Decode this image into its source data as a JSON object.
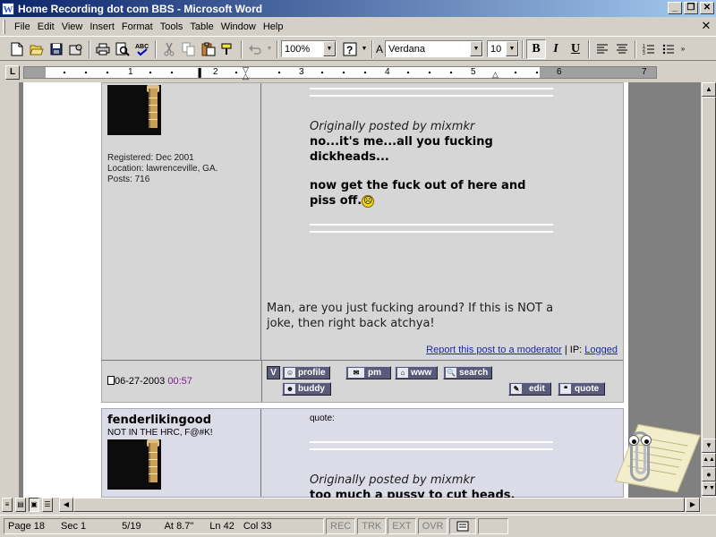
{
  "window": {
    "title": "Home Recording dot com BBS - Microsoft Word",
    "app_icon": "W",
    "minimize_glyph": "_",
    "restore_glyph": "❐",
    "close_glyph": "✕"
  },
  "menu": {
    "items": [
      "File",
      "Edit",
      "View",
      "Insert",
      "Format",
      "Tools",
      "Table",
      "Window",
      "Help"
    ],
    "close_doc_glyph": "✕"
  },
  "toolbar": {
    "zoom": "100%",
    "font": "Verdana",
    "size": "10",
    "bold_label": "B",
    "italic_label": "I",
    "underline_label": "U",
    "icons": [
      "new-icon",
      "open-icon",
      "save-icon",
      "permission-icon",
      "print-icon",
      "print-preview-icon",
      "spelling-icon",
      "cut-icon",
      "copy-icon",
      "paste-icon",
      "format-painter-icon",
      "undo-icon",
      "help-icon",
      "align-left-icon",
      "center-icon",
      "numbering-icon",
      "bullets-icon",
      "more-buttons-icon"
    ]
  },
  "ruler": {
    "tab_selector": "L",
    "numbers": [
      "1",
      "2",
      "3",
      "4",
      "5",
      "6",
      "7"
    ]
  },
  "post1": {
    "registered": "Registered: Dec 2001",
    "location": "Location: lawrenceville, GA.",
    "posts": "Posts: 716",
    "quote_by": "Originally posted by mixmkr",
    "quote_line1": "no...it's me...all you fucking",
    "quote_line2": "dickheads...",
    "quote_line3": "now get the fuck out of here and",
    "quote_line4": "piss off.",
    "reply_line1": "Man, are you just fucking around? If this is NOT a",
    "reply_line2": "joke, then right back atchya!",
    "report_link": "Report this post to a moderator",
    "ip_label": " | IP: ",
    "ip_link": "Logged",
    "date": "06-27-2003",
    "time": "00:57",
    "buttons": {
      "v": "V",
      "profile": "profile",
      "pm": "pm",
      "www": "www",
      "search": "search",
      "buddy": "buddy",
      "edit": "edit",
      "quote": "quote"
    }
  },
  "post2": {
    "username": "fenderlikingood",
    "user_title": "NOT IN THE HRC, F@#K!",
    "quote_label": "quote:",
    "quote_by": "Originally posted by mixmkr",
    "quote_line1": "too much a pussy to cut heads,"
  },
  "statusbar": {
    "page_label": "Page",
    "page": "18",
    "sec_label": "Sec",
    "sec": "1",
    "page_of": "5/19",
    "at_label": "At",
    "at": "8.7\"",
    "ln_label": "Ln",
    "ln": "42",
    "col_label": "Col",
    "col": "33",
    "rec": "REC",
    "trk": "TRK",
    "ext": "EXT",
    "ovr": "OVR"
  }
}
